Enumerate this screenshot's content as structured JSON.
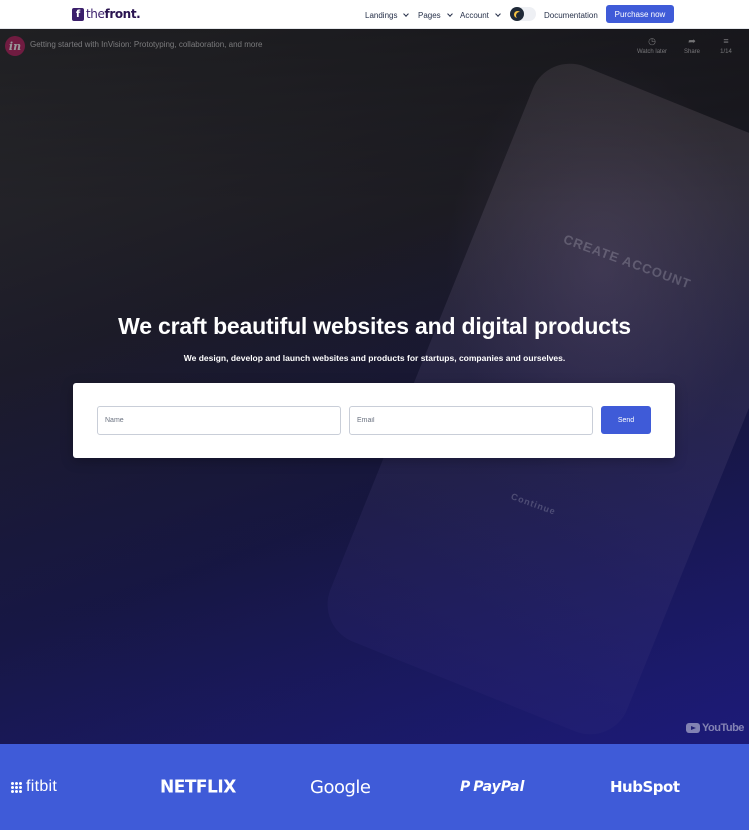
{
  "navbar": {
    "logo_mark": "f",
    "logo_text_prefix": "the",
    "logo_text_suffix": "front.",
    "menu": [
      {
        "label": "Landings",
        "icon": "chevron-down-icon"
      },
      {
        "label": "Pages",
        "icon": "chevron-down-icon"
      },
      {
        "label": "Account",
        "icon": "chevron-down-icon"
      }
    ],
    "theme_toggle_icon": "moon-icon",
    "documentation_label": "Documentation",
    "purchase_label": "Purchase now"
  },
  "video": {
    "channel_icon": "invision-logo",
    "channel_mark": "in",
    "title": "Getting started with InVision: Prototyping, collaboration, and more",
    "actions": [
      {
        "label": "Watch later",
        "icon": "clock-icon"
      },
      {
        "label": "Share",
        "icon": "share-icon"
      },
      {
        "label": "1/14",
        "icon": "playlist-icon"
      }
    ],
    "background_text": [
      "CREATE ACCOUNT",
      "Continue"
    ],
    "youtube_word": "YouTube"
  },
  "hero": {
    "title": "We craft beautiful websites and digital products",
    "subtitle": "We design, develop and launch websites and products for startups, companies and ourselves."
  },
  "form": {
    "name_placeholder": "Name",
    "email_placeholder": "Email",
    "send_label": "Send"
  },
  "partners": [
    {
      "name": "fitbit",
      "icon": "fitbit-logo"
    },
    {
      "name": "NETFLIX",
      "icon": "netflix-logo"
    },
    {
      "name": "Google",
      "icon": "google-logo"
    },
    {
      "name": "PayPal",
      "icon": "paypal-logo"
    },
    {
      "name": "HubSpot",
      "icon": "hubspot-logo"
    }
  ],
  "colors": {
    "primary": "#3f5bd8",
    "brand_dark": "#3b1f6b",
    "nav_text": "#27314a",
    "hero_bottom": "#1c1a73"
  }
}
